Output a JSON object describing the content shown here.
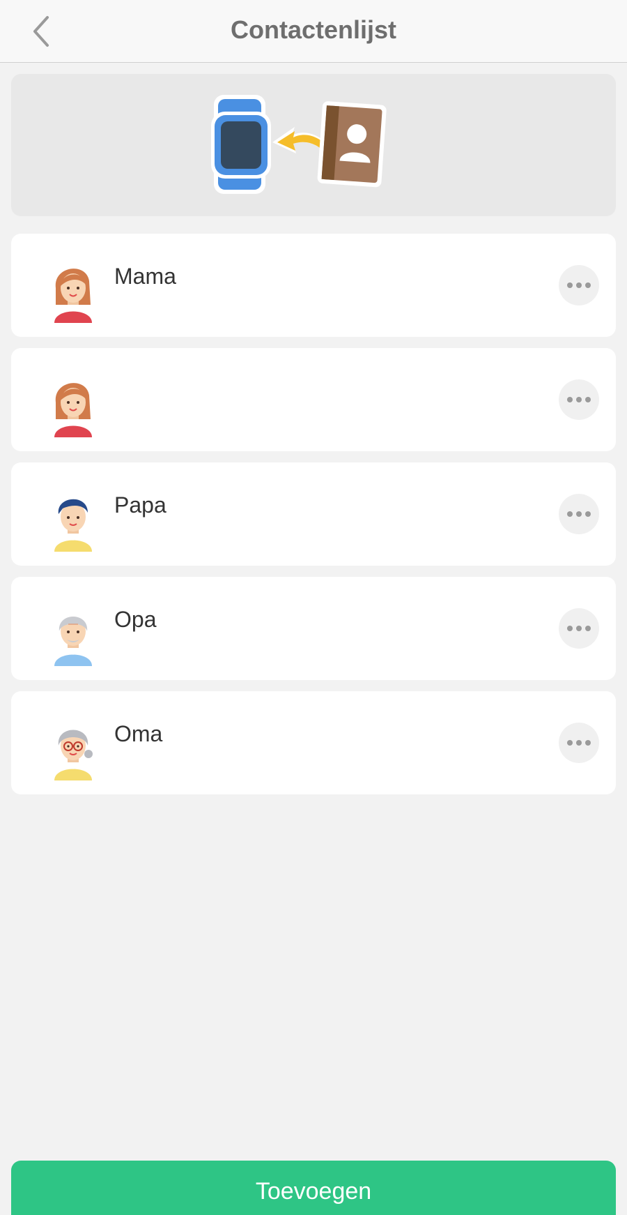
{
  "header": {
    "title": "Contactenlijst",
    "back_icon": "chevron-left-icon"
  },
  "banner": {
    "icons": [
      "smartwatch-icon",
      "arrow-icon",
      "contact-book-icon"
    ],
    "colors": {
      "watch": "#4a90e2",
      "arrow": "#f5bd2a",
      "book": "#a3775a"
    }
  },
  "contacts": [
    {
      "name": "Mama",
      "avatar": "woman-avatar"
    },
    {
      "name": "",
      "avatar": "woman-avatar"
    },
    {
      "name": "Papa",
      "avatar": "man-avatar"
    },
    {
      "name": "Opa",
      "avatar": "grandpa-avatar"
    },
    {
      "name": "Oma",
      "avatar": "grandma-avatar"
    }
  ],
  "footer": {
    "add_label": "Toevoegen",
    "accent_color": "#2ec585"
  }
}
